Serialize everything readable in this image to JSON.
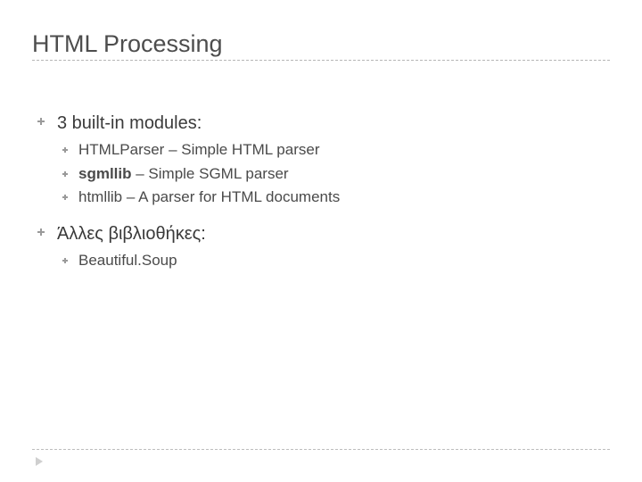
{
  "title": "HTML Processing",
  "items": [
    {
      "label": "3 built-in modules:",
      "sub_plain_0": "HTMLParser – Simple HTML parser",
      "sub_bold_1a": "sgmllib",
      "sub_plain_1b": " – Simple SGML parser",
      "sub_plain_2": "htmllib – A parser for HTML documents"
    },
    {
      "label": "Άλλες βιβλιοθήκες:",
      "sub_plain_0": "Beautiful.Soup"
    }
  ]
}
